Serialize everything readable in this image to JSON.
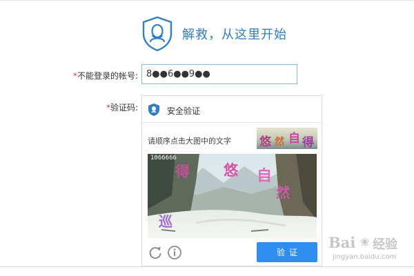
{
  "header": {
    "title": "解救，从这里开始"
  },
  "form": {
    "account": {
      "required_mark": "*",
      "label": "不能登录的帐号:",
      "value": "8●●6●●9●●"
    },
    "captcha": {
      "required_mark": "*",
      "label": "验证码:"
    }
  },
  "captcha_panel": {
    "title": "安全验证",
    "instruction": "请顺序点击大图中的文字",
    "target_chars": [
      "悠",
      "然",
      "自",
      "得"
    ],
    "image_id": "1066666",
    "scene_chars": [
      "得",
      "悠",
      "自",
      "然",
      "巡"
    ],
    "verify_label": "验证",
    "icons": {
      "header": "shield-icon",
      "refresh": "refresh-icon",
      "info": "info-icon"
    }
  },
  "watermark": {
    "logo": "Bai",
    "brand": "经验",
    "url": "jingyan.baidu.com"
  },
  "colors": {
    "brand_blue": "#2f7ec7",
    "button_blue": "#2d8ef0",
    "required_red": "#e23a3a",
    "input_border": "#7eb8e6"
  }
}
